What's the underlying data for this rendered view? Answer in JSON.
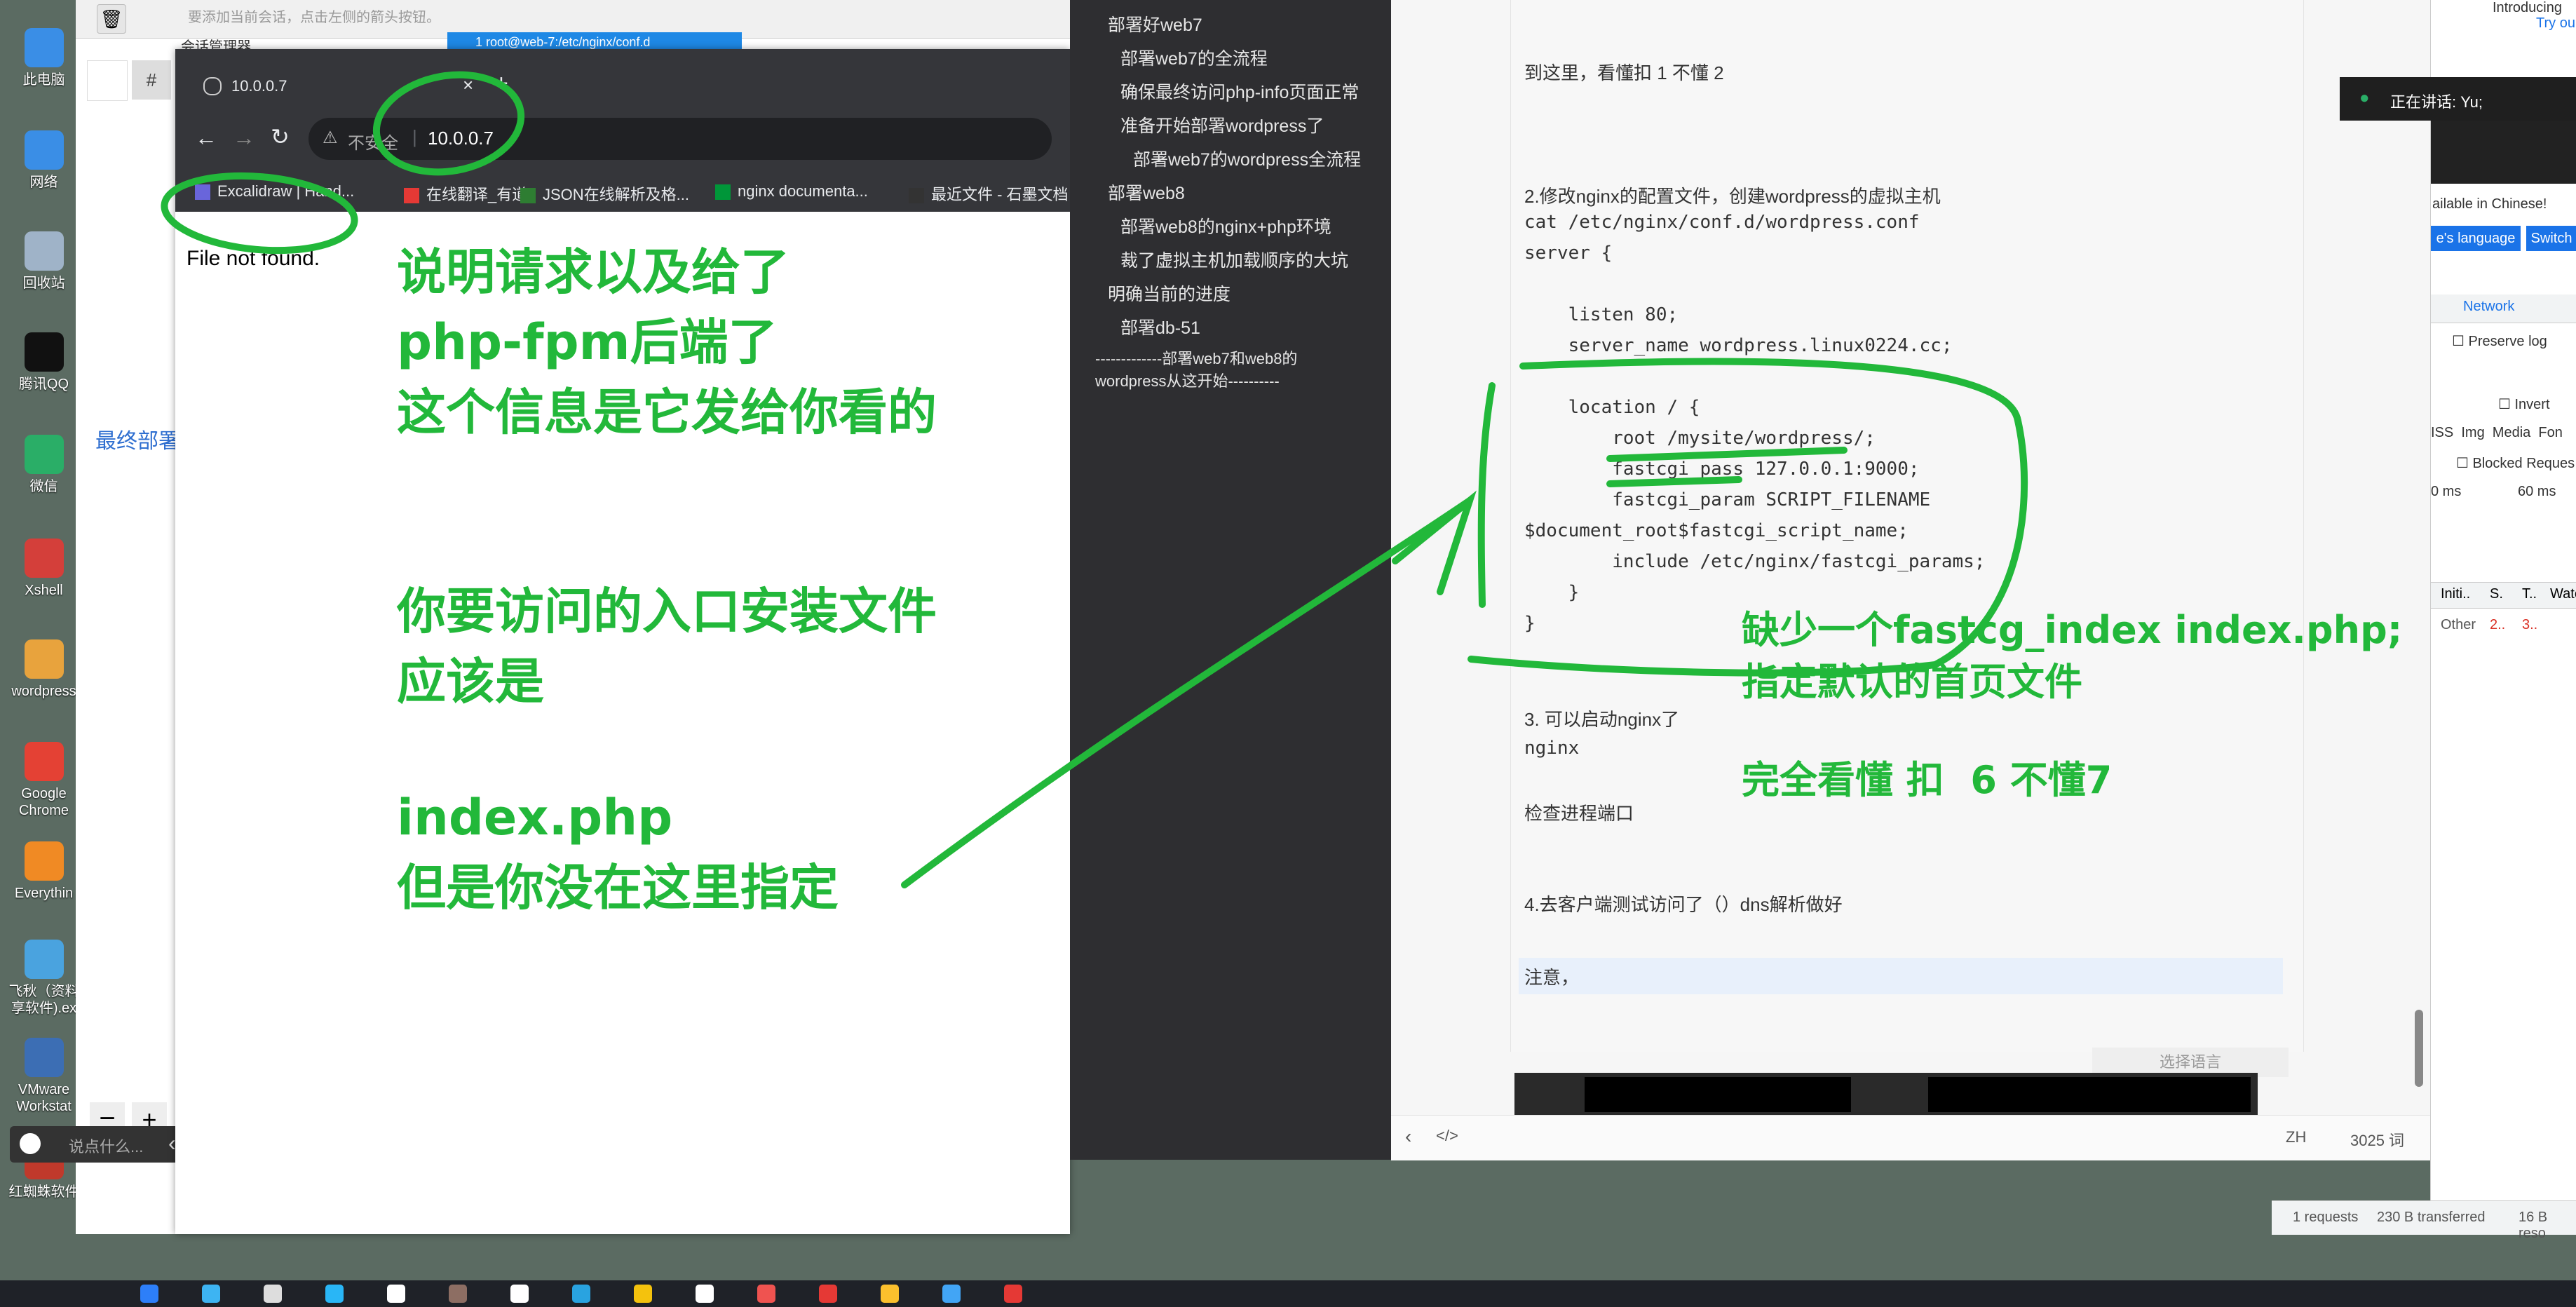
{
  "desktop": {
    "icons": [
      {
        "label": "此电脑",
        "name": "this-pc-icon",
        "color": "#3a8ee6"
      },
      {
        "label": "网络",
        "name": "network-icon",
        "color": "#3a8ee6"
      },
      {
        "label": "回收站",
        "name": "recycle-bin-icon",
        "color": "#9fb3c8"
      },
      {
        "label": "腾讯QQ",
        "name": "qq-icon",
        "color": "#111111"
      },
      {
        "label": "微信",
        "name": "wechat-icon",
        "color": "#2aae67"
      },
      {
        "label": "Xshell",
        "name": "xshell-icon",
        "color": "#d43f3a"
      },
      {
        "label": "wordpress",
        "name": "wordpress-folder-icon",
        "color": "#e8a33d"
      },
      {
        "label": "Google Chrome",
        "name": "chrome-icon",
        "color": "#e44134"
      },
      {
        "label": "Everythin",
        "name": "everything-icon",
        "color": "#f08a24"
      },
      {
        "label": "飞秋（资料享软件).ex",
        "name": "feiqiu-icon",
        "color": "#4aa3df"
      },
      {
        "label": "VMware Workstat",
        "name": "vmware-icon",
        "color": "#3c6eb4"
      },
      {
        "label": "红蜘蛛软件",
        "name": "red-spider-icon",
        "color": "#c0392b"
      }
    ]
  },
  "leftapp": {
    "banner": "要添加当前会话，点击左侧的箭头按钮。",
    "session_manager_tab": "会话管理器",
    "terminal_tab": "1 root@web-7:/etc/nginx/conf.d",
    "hash_button": "#",
    "partial_link": "最终部署",
    "minus_button": "−",
    "plus_button": "+",
    "chat_placeholder": "说点什么...",
    "collapse_arrow": "‹"
  },
  "browser": {
    "tab_title": "10.0.0.7",
    "not_secure": "不安全",
    "url": "10.0.0.7",
    "bookmarks": [
      {
        "label": "Excalidraw | Hand...",
        "color": "#6965db"
      },
      {
        "label": "在线翻译_有道",
        "color": "#e53935"
      },
      {
        "label": "JSON在线解析及格...",
        "color": "#2e7d32"
      },
      {
        "label": "nginx documenta...",
        "color": "#009639"
      },
      {
        "label": "最近文件 - 石墨文档",
        "color": "#333333"
      }
    ],
    "page_text": "File not found."
  },
  "outline": {
    "items": [
      {
        "text": "部署好web7",
        "level": 1
      },
      {
        "text": "部署web7的全流程",
        "level": 2
      },
      {
        "text": "确保最终访问php-info页面正常",
        "level": 2
      },
      {
        "text": "准备开始部署wordpress了",
        "level": 2
      },
      {
        "text": "部署web7的wordpress全流程",
        "level": 3
      },
      {
        "text": "部署web8",
        "level": 1
      },
      {
        "text": "部署web8的nginx+php环境",
        "level": 2
      },
      {
        "text": "裁了虚拟主机加载顺序的大坑",
        "level": 2
      },
      {
        "text": "明确当前的进度",
        "level": 1
      },
      {
        "text": "部署db-51",
        "level": 2
      },
      {
        "text": "-------------部署web7和web8的",
        "level": 0
      },
      {
        "text": "wordpress从这开始----------",
        "level": 0
      }
    ]
  },
  "editor": {
    "lines": [
      "到这里，看懂扣 1 不懂 2",
      "2.修改nginx的配置文件，创建wordpress的虚拟主机",
      "cat /etc/nginx/conf.d/wordpress.conf",
      "server {",
      "    listen 80;",
      "    server_name wordpress.linux0224.cc;",
      "    location / {",
      "        root /mysite/wordpress/;",
      "        fastcgi_pass 127.0.0.1:9000;",
      "        fastcgi_param SCRIPT_FILENAME",
      "$document_root$fastcgi_script_name;",
      "        include /etc/nginx/fastcgi_params;",
      "    }",
      "}",
      "3. 可以启动nginx了",
      "nginx",
      "检查进程端口",
      "4.去客户端测试访问了（）dns解析做好",
      "注意，"
    ],
    "language_hint": "选择语言",
    "status_lang": "ZH",
    "word_count": "3025 词"
  },
  "devtools": {
    "introducing": "Introducing",
    "try_out": "Try ou",
    "speaking": "正在讲话: Yu;",
    "available": "ailable in Chinese!",
    "language_btn": "e's language",
    "switch_btn": "Switch",
    "network_tab": "Network",
    "preserve_log": "Preserve log",
    "invert": "Invert",
    "filters": "ISS  Img  Media  Fon",
    "blocked": "Blocked Reques",
    "ms1": "0 ms",
    "ms2": "60 ms",
    "col_initiator": "Initi..",
    "col_s": "S.",
    "col_t": "T..",
    "col_w": "Wate",
    "row_initiator": "Other",
    "row_s": "2..",
    "row_t": "3..",
    "status_requests": "1 requests",
    "status_transferred": "230 B transferred",
    "status_resources": "16 B reso"
  },
  "annotations": {
    "a1": "说明请求以及给了\nphp-fpm后端了\n这个信息是它发给你看的",
    "a2": "你要访问的入口安装文件\n应该是",
    "a3": "index.php\n但是你没在这里指定",
    "a4": "缺少一个fastcg_index index.php;\n指定默认的首页文件",
    "a5": "完全看懂 扣  6 不懂7",
    "color": "#22b83a"
  }
}
